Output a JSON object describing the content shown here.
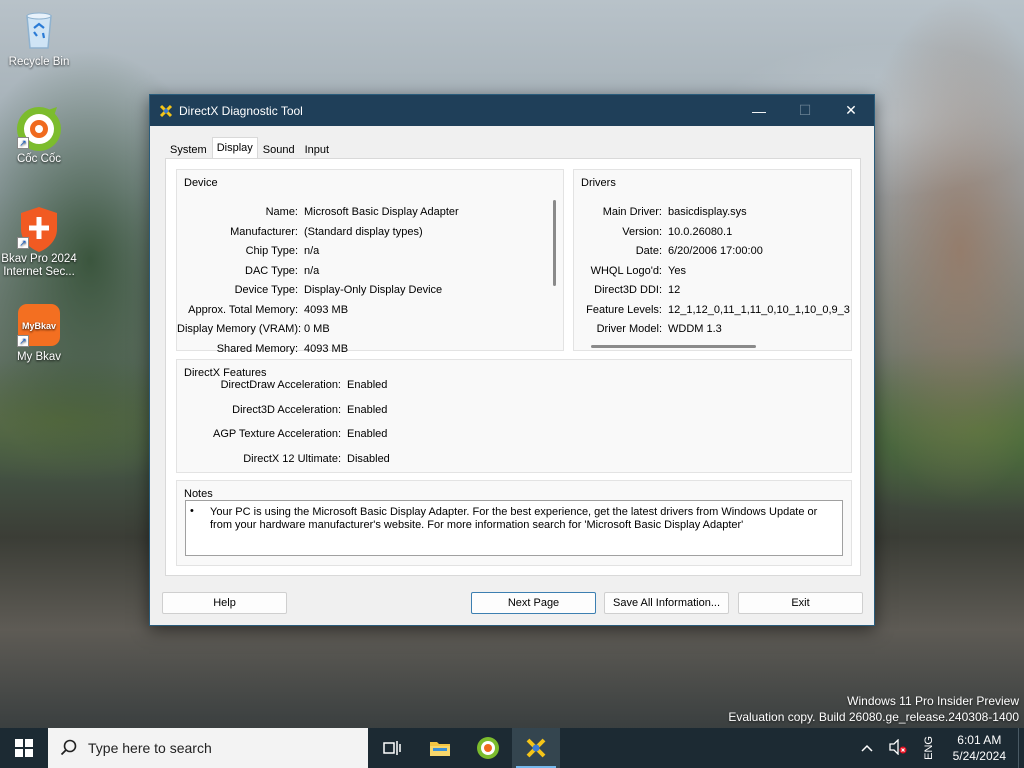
{
  "desktop": {
    "icons": [
      {
        "label": "Recycle Bin"
      },
      {
        "label": "Cốc Cốc"
      },
      {
        "label": "Bkav Pro 2024 Internet Sec..."
      },
      {
        "label": "My Bkav"
      }
    ],
    "watermark": {
      "line1": "Windows 11 Pro Insider Preview",
      "line2": "Evaluation copy. Build 26080.ge_release.240308-1400"
    }
  },
  "window": {
    "title": "DirectX Diagnostic Tool",
    "controls": {
      "minimize": "—",
      "maximize": "☐",
      "close": "✕"
    },
    "tabs": [
      "System",
      "Display",
      "Sound",
      "Input"
    ],
    "active_tab": "Display",
    "device": {
      "title": "Device",
      "rows": [
        {
          "k": "Name:",
          "v": "Microsoft Basic Display Adapter"
        },
        {
          "k": "Manufacturer:",
          "v": "(Standard display types)"
        },
        {
          "k": "Chip Type:",
          "v": "n/a"
        },
        {
          "k": "DAC Type:",
          "v": "n/a"
        },
        {
          "k": "Device Type:",
          "v": "Display-Only Display Device"
        },
        {
          "k": "Approx. Total Memory:",
          "v": "4093 MB"
        },
        {
          "k": "Display Memory (VRAM):",
          "v": "0 MB"
        },
        {
          "k": "Shared Memory:",
          "v": "4093 MB"
        }
      ]
    },
    "drivers": {
      "title": "Drivers",
      "rows": [
        {
          "k": "Main Driver:",
          "v": "basicdisplay.sys"
        },
        {
          "k": "Version:",
          "v": "10.0.26080.1"
        },
        {
          "k": "Date:",
          "v": "6/20/2006 17:00:00"
        },
        {
          "k": "WHQL Logo'd:",
          "v": "Yes"
        },
        {
          "k": "Direct3D DDI:",
          "v": "12"
        },
        {
          "k": "Feature Levels:",
          "v": "12_1,12_0,11_1,11_0,10_1,10_0,9_3"
        },
        {
          "k": "Driver Model:",
          "v": "WDDM 1.3"
        }
      ]
    },
    "features": {
      "title": "DirectX Features",
      "rows": [
        {
          "k": "DirectDraw Acceleration:",
          "v": "Enabled"
        },
        {
          "k": "Direct3D Acceleration:",
          "v": "Enabled"
        },
        {
          "k": "AGP Texture Acceleration:",
          "v": "Enabled"
        },
        {
          "k": "DirectX 12 Ultimate:",
          "v": "Disabled"
        }
      ]
    },
    "notes": {
      "title": "Notes",
      "bullet": "•",
      "text": "Your PC is using the Microsoft Basic Display Adapter. For the best experience, get the latest drivers from Windows Update or from your hardware manufacturer's website. For more information search for 'Microsoft Basic Display Adapter'"
    },
    "buttons": {
      "help": "Help",
      "next": "Next Page",
      "save": "Save All Information...",
      "exit": "Exit"
    }
  },
  "taskbar": {
    "search_placeholder": "Type here to search",
    "apps": [
      "task-view-icon",
      "file-explorer-icon",
      "coc-coc-icon",
      "directx-icon"
    ],
    "tray": {
      "lang": "ENG",
      "time": "6:01 AM",
      "date": "5/24/2024"
    }
  },
  "colors": {
    "titlebar": "#1f3f59",
    "taskbar": "#1c2a33",
    "default_button_border": "#3c7fb1"
  }
}
